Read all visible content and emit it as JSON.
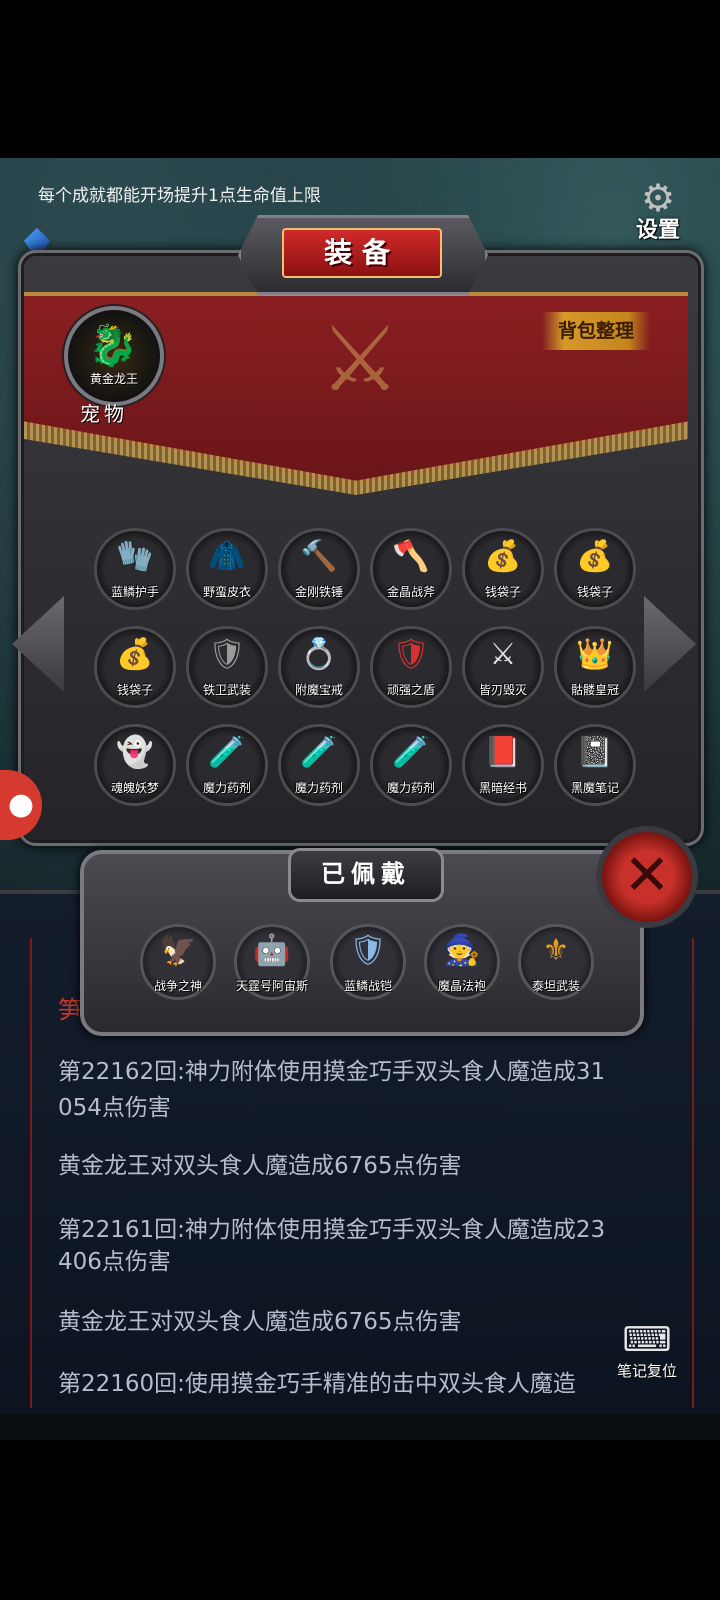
{
  "header": {
    "tip": "每个成就都能开场提升1点生命值上限",
    "gem_count": "???",
    "settings_label": "设置"
  },
  "equipment_panel": {
    "title": "装备",
    "sort_button": "背包整理",
    "pet": {
      "name": "黄金龙王",
      "label": "宠物"
    },
    "items": [
      {
        "name": "蓝鳞护手",
        "icon": "gauntlet-icon",
        "glyph": "🧤",
        "color": "#5b6bd8"
      },
      {
        "name": "野蛮皮衣",
        "icon": "leather-armor-icon",
        "glyph": "🧥",
        "color": "#d6b03a"
      },
      {
        "name": "金刚铁锤",
        "icon": "hammer-icon",
        "glyph": "🔨",
        "color": "#9a9a9a"
      },
      {
        "name": "金晶战斧",
        "icon": "axe-icon",
        "glyph": "🪓",
        "color": "#7b4bd0"
      },
      {
        "name": "钱袋子",
        "icon": "money-bag-icon",
        "glyph": "💰",
        "color": "#5ea86a"
      },
      {
        "name": "钱袋子",
        "icon": "money-bag-icon",
        "glyph": "💰",
        "color": "#5ea86a"
      },
      {
        "name": "钱袋子",
        "icon": "money-bag-icon",
        "glyph": "💰",
        "color": "#5ea86a"
      },
      {
        "name": "铁卫武装",
        "icon": "iron-armor-icon",
        "glyph": "🛡",
        "color": "#9a9a9a"
      },
      {
        "name": "附魔宝戒",
        "icon": "ring-icon",
        "glyph": "💍",
        "color": "#d8683a"
      },
      {
        "name": "顽强之盾",
        "icon": "shield-icon",
        "glyph": "🛡",
        "color": "#d83030"
      },
      {
        "name": "皆刃毁灭",
        "icon": "crossed-blades-icon",
        "glyph": "⚔",
        "color": "#e0e0e0"
      },
      {
        "name": "骷髅皇冠",
        "icon": "crown-icon",
        "glyph": "👑",
        "color": "#e8a020"
      },
      {
        "name": "魂魄妖梦",
        "icon": "ghost-girl-icon",
        "glyph": "👻",
        "color": "#d8d8f0"
      },
      {
        "name": "魔力药剂",
        "icon": "potion-icon",
        "glyph": "🧪",
        "color": "#3a6ae8"
      },
      {
        "name": "魔力药剂",
        "icon": "potion-icon",
        "glyph": "🧪",
        "color": "#3a6ae8"
      },
      {
        "name": "魔力药剂",
        "icon": "potion-icon",
        "glyph": "🧪",
        "color": "#3a6ae8"
      },
      {
        "name": "黑暗经书",
        "icon": "red-book-icon",
        "glyph": "📕",
        "color": "#d83030"
      },
      {
        "name": "黑魔笔记",
        "icon": "dark-notebook-icon",
        "glyph": "📓",
        "color": "#8a8a8a"
      }
    ]
  },
  "worn_panel": {
    "title": "已佩戴",
    "items": [
      {
        "name": "战争之神",
        "icon": "war-god-icon",
        "glyph": "🦅",
        "color": "#d04040"
      },
      {
        "name": "天霆号阿宙斯",
        "icon": "mech-icon",
        "glyph": "🤖",
        "color": "#e0e0e0"
      },
      {
        "name": "蓝鳞战铠",
        "icon": "blue-armor-icon",
        "glyph": "🛡",
        "color": "#8ab8e8"
      },
      {
        "name": "魔晶法袍",
        "icon": "robe-icon",
        "glyph": "🧙",
        "color": "#6a4ad0"
      },
      {
        "name": "泰坦武装",
        "icon": "titan-armor-icon",
        "glyph": "⚜",
        "color": "#e8a020"
      }
    ]
  },
  "battle_log": {
    "partial_top": "笋",
    "lines": [
      "第22162回:神力附体使用摸金巧手双头食人魔造成31",
      "054点伤害",
      "黄金龙王对双头食人魔造成6765点伤害",
      "第22161回:神力附体使用摸金巧手双头食人魔造成23",
      "406点伤害",
      "黄金龙王对双头食人魔造成6765点伤害",
      "第22160回:使用摸金巧手精准的击中双头食人魔造"
    ]
  },
  "note_reset_label": "笔记复位",
  "colors": {
    "accent_red": "#8a1f22",
    "gold": "#d59a2a",
    "log_text": "#b6bccb"
  }
}
